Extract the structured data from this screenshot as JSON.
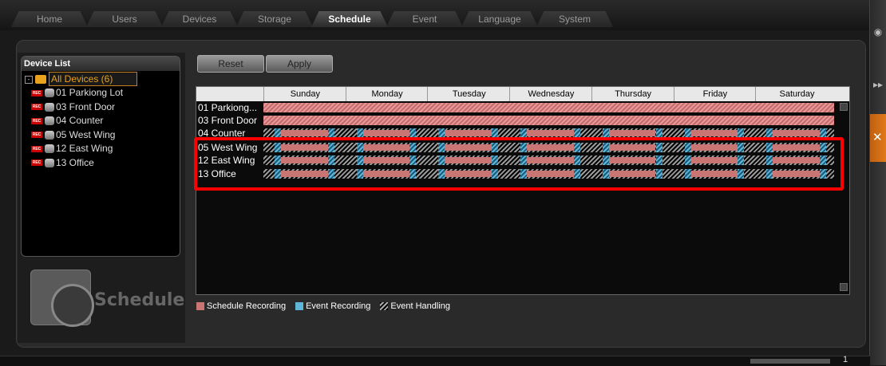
{
  "tabs": [
    "Home",
    "Users",
    "Devices",
    "Storage",
    "Schedule",
    "Event",
    "Language",
    "System"
  ],
  "active_tab": "Schedule",
  "device_list": {
    "title": "Device List",
    "root_label": "All Devices (6)",
    "expander": "-",
    "devices": [
      {
        "label": "01  Parkiong Lot"
      },
      {
        "label": "03  Front Door"
      },
      {
        "label": "04  Counter"
      },
      {
        "label": "05  West Wing"
      },
      {
        "label": "12  East Wing"
      },
      {
        "label": "13  Office"
      }
    ]
  },
  "logo_text": "Schedule",
  "buttons": {
    "reset": "Reset",
    "apply": "Apply"
  },
  "days": [
    "Sunday",
    "Monday",
    "Tuesday",
    "Wednesday",
    "Thursday",
    "Friday",
    "Saturday"
  ],
  "rows": [
    {
      "label": "01 Parkiong...",
      "type": "schedule"
    },
    {
      "label": "03 Front Door",
      "type": "schedule"
    },
    {
      "label": "04 Counter",
      "type": "event"
    },
    {
      "label": "05 West Wing",
      "type": "event"
    },
    {
      "label": "12 East Wing",
      "type": "event"
    },
    {
      "label": "13 Office",
      "type": "event"
    }
  ],
  "legend": {
    "schedule": "Schedule Recording",
    "event": "Event Recording",
    "handling": "Event Handling"
  },
  "colors": {
    "highlight": "#ff0000",
    "accent": "#e07a1a",
    "schedule": "#c97574",
    "event": "#5fb6d8"
  },
  "status": {
    "page": "1"
  }
}
